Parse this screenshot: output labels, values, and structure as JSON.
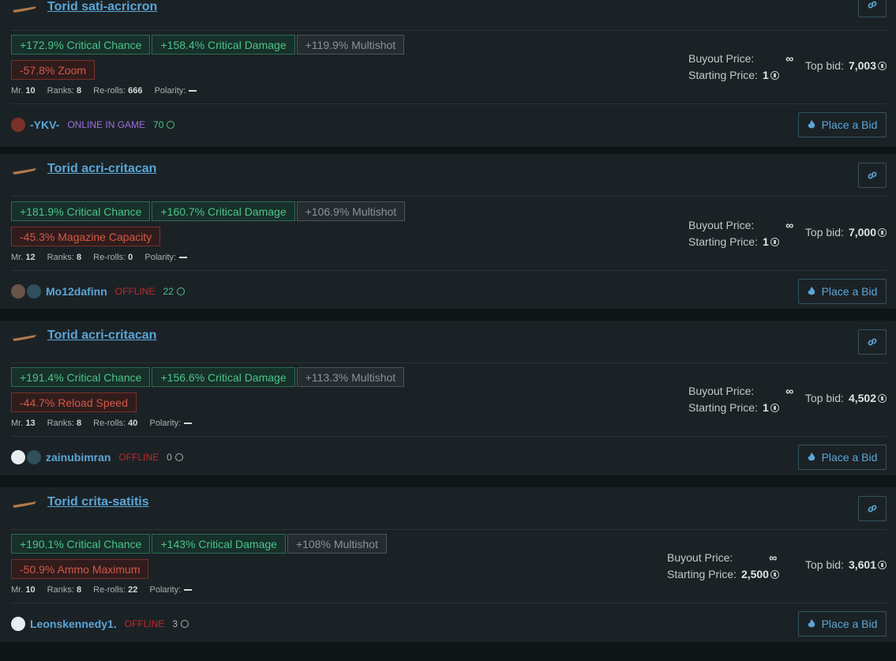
{
  "listings": [
    {
      "title": "Torid sati-acricron",
      "stats": [
        "+172.9% Critical Chance",
        "+158.4% Critical Damage",
        "+119.9% Multishot"
      ],
      "negative": "-57.8% Zoom",
      "meta": {
        "mr_label": "Mr.",
        "mr": "10",
        "ranks_label": "Ranks:",
        "ranks": "8",
        "rerolls_label": "Re-rolls:",
        "rerolls": "666",
        "polarity_label": "Polarity:"
      },
      "buyout_label": "Buyout Price:",
      "buyout": "∞",
      "starting_label": "Starting Price:",
      "starting": "1",
      "topbid_label": "Top bid:",
      "topbid": "7,003",
      "user": "-YKV-",
      "status": "ONLINE IN GAME",
      "reputation": "70",
      "bid_label": "Place a Bid"
    },
    {
      "title": "Torid acri-critacan",
      "stats": [
        "+181.9% Critical Chance",
        "+160.7% Critical Damage",
        "+106.9% Multishot"
      ],
      "negative": "-45.3% Magazine Capacity",
      "meta": {
        "mr_label": "Mr.",
        "mr": "12",
        "ranks_label": "Ranks:",
        "ranks": "8",
        "rerolls_label": "Re-rolls:",
        "rerolls": "0",
        "polarity_label": "Polarity:"
      },
      "buyout_label": "Buyout Price:",
      "buyout": "∞",
      "starting_label": "Starting Price:",
      "starting": "1",
      "topbid_label": "Top bid:",
      "topbid": "7,000",
      "user": "Mo12dafinn",
      "status": "OFFLINE",
      "reputation": "22",
      "bid_label": "Place a Bid"
    },
    {
      "title": "Torid acri-critacan",
      "stats": [
        "+191.4% Critical Chance",
        "+156.6% Critical Damage",
        "+113.3% Multishot"
      ],
      "negative": "-44.7% Reload Speed",
      "meta": {
        "mr_label": "Mr.",
        "mr": "13",
        "ranks_label": "Ranks:",
        "ranks": "8",
        "rerolls_label": "Re-rolls:",
        "rerolls": "40",
        "polarity_label": "Polarity:"
      },
      "buyout_label": "Buyout Price:",
      "buyout": "∞",
      "starting_label": "Starting Price:",
      "starting": "1",
      "topbid_label": "Top bid:",
      "topbid": "4,502",
      "user": "zainubimran",
      "status": "OFFLINE",
      "reputation": "0",
      "bid_label": "Place a Bid"
    },
    {
      "title": "Torid crita-satitis",
      "stats": [
        "+190.1% Critical Chance",
        "+143% Critical Damage",
        "+108% Multishot"
      ],
      "negative": "-50.9% Ammo Maximum",
      "meta": {
        "mr_label": "Mr.",
        "mr": "10",
        "ranks_label": "Ranks:",
        "ranks": "8",
        "rerolls_label": "Re-rolls:",
        "rerolls": "22",
        "polarity_label": "Polarity:"
      },
      "buyout_label": "Buyout Price:",
      "buyout": "∞",
      "starting_label": "Starting Price:",
      "starting": "2,500",
      "topbid_label": "Top bid:",
      "topbid": "3,601",
      "user": "Leonskennedy1.",
      "status": "OFFLINE",
      "reputation": "3",
      "bid_label": "Place a Bid"
    }
  ],
  "colors": {
    "accent": "#5ba6d6",
    "positive": "#4cc38a",
    "negative": "#d25848",
    "online": "#9b6fe0",
    "offline": "#c0282a"
  }
}
